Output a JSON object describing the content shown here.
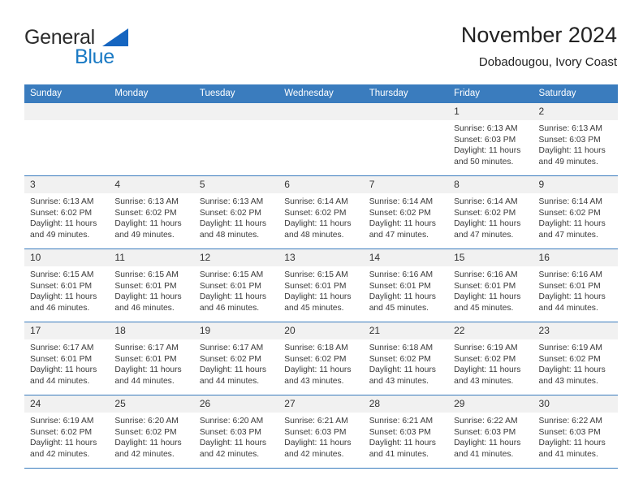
{
  "logo": {
    "word_one": "General",
    "word_two": "Blue",
    "accent_color": "#1a7ac4",
    "triangle_color": "#1565c0"
  },
  "header": {
    "title": "November 2024",
    "subtitle": "Dobadougou, Ivory Coast"
  },
  "theme": {
    "header_row_color": "#3a7cbe",
    "daynum_band_color": "#f1f1f1",
    "text_color": "#3a3a3a"
  },
  "weekday_headers": [
    "Sunday",
    "Monday",
    "Tuesday",
    "Wednesday",
    "Thursday",
    "Friday",
    "Saturday"
  ],
  "weeks": [
    [
      {
        "day": "",
        "empty": true
      },
      {
        "day": "",
        "empty": true
      },
      {
        "day": "",
        "empty": true
      },
      {
        "day": "",
        "empty": true
      },
      {
        "day": "",
        "empty": true
      },
      {
        "day": "1",
        "sunrise": "Sunrise: 6:13 AM",
        "sunset": "Sunset: 6:03 PM",
        "daylight1": "Daylight: 11 hours",
        "daylight2": "and 50 minutes."
      },
      {
        "day": "2",
        "sunrise": "Sunrise: 6:13 AM",
        "sunset": "Sunset: 6:03 PM",
        "daylight1": "Daylight: 11 hours",
        "daylight2": "and 49 minutes."
      }
    ],
    [
      {
        "day": "3",
        "sunrise": "Sunrise: 6:13 AM",
        "sunset": "Sunset: 6:02 PM",
        "daylight1": "Daylight: 11 hours",
        "daylight2": "and 49 minutes."
      },
      {
        "day": "4",
        "sunrise": "Sunrise: 6:13 AM",
        "sunset": "Sunset: 6:02 PM",
        "daylight1": "Daylight: 11 hours",
        "daylight2": "and 49 minutes."
      },
      {
        "day": "5",
        "sunrise": "Sunrise: 6:13 AM",
        "sunset": "Sunset: 6:02 PM",
        "daylight1": "Daylight: 11 hours",
        "daylight2": "and 48 minutes."
      },
      {
        "day": "6",
        "sunrise": "Sunrise: 6:14 AM",
        "sunset": "Sunset: 6:02 PM",
        "daylight1": "Daylight: 11 hours",
        "daylight2": "and 48 minutes."
      },
      {
        "day": "7",
        "sunrise": "Sunrise: 6:14 AM",
        "sunset": "Sunset: 6:02 PM",
        "daylight1": "Daylight: 11 hours",
        "daylight2": "and 47 minutes."
      },
      {
        "day": "8",
        "sunrise": "Sunrise: 6:14 AM",
        "sunset": "Sunset: 6:02 PM",
        "daylight1": "Daylight: 11 hours",
        "daylight2": "and 47 minutes."
      },
      {
        "day": "9",
        "sunrise": "Sunrise: 6:14 AM",
        "sunset": "Sunset: 6:02 PM",
        "daylight1": "Daylight: 11 hours",
        "daylight2": "and 47 minutes."
      }
    ],
    [
      {
        "day": "10",
        "sunrise": "Sunrise: 6:15 AM",
        "sunset": "Sunset: 6:01 PM",
        "daylight1": "Daylight: 11 hours",
        "daylight2": "and 46 minutes."
      },
      {
        "day": "11",
        "sunrise": "Sunrise: 6:15 AM",
        "sunset": "Sunset: 6:01 PM",
        "daylight1": "Daylight: 11 hours",
        "daylight2": "and 46 minutes."
      },
      {
        "day": "12",
        "sunrise": "Sunrise: 6:15 AM",
        "sunset": "Sunset: 6:01 PM",
        "daylight1": "Daylight: 11 hours",
        "daylight2": "and 46 minutes."
      },
      {
        "day": "13",
        "sunrise": "Sunrise: 6:15 AM",
        "sunset": "Sunset: 6:01 PM",
        "daylight1": "Daylight: 11 hours",
        "daylight2": "and 45 minutes."
      },
      {
        "day": "14",
        "sunrise": "Sunrise: 6:16 AM",
        "sunset": "Sunset: 6:01 PM",
        "daylight1": "Daylight: 11 hours",
        "daylight2": "and 45 minutes."
      },
      {
        "day": "15",
        "sunrise": "Sunrise: 6:16 AM",
        "sunset": "Sunset: 6:01 PM",
        "daylight1": "Daylight: 11 hours",
        "daylight2": "and 45 minutes."
      },
      {
        "day": "16",
        "sunrise": "Sunrise: 6:16 AM",
        "sunset": "Sunset: 6:01 PM",
        "daylight1": "Daylight: 11 hours",
        "daylight2": "and 44 minutes."
      }
    ],
    [
      {
        "day": "17",
        "sunrise": "Sunrise: 6:17 AM",
        "sunset": "Sunset: 6:01 PM",
        "daylight1": "Daylight: 11 hours",
        "daylight2": "and 44 minutes."
      },
      {
        "day": "18",
        "sunrise": "Sunrise: 6:17 AM",
        "sunset": "Sunset: 6:01 PM",
        "daylight1": "Daylight: 11 hours",
        "daylight2": "and 44 minutes."
      },
      {
        "day": "19",
        "sunrise": "Sunrise: 6:17 AM",
        "sunset": "Sunset: 6:02 PM",
        "daylight1": "Daylight: 11 hours",
        "daylight2": "and 44 minutes."
      },
      {
        "day": "20",
        "sunrise": "Sunrise: 6:18 AM",
        "sunset": "Sunset: 6:02 PM",
        "daylight1": "Daylight: 11 hours",
        "daylight2": "and 43 minutes."
      },
      {
        "day": "21",
        "sunrise": "Sunrise: 6:18 AM",
        "sunset": "Sunset: 6:02 PM",
        "daylight1": "Daylight: 11 hours",
        "daylight2": "and 43 minutes."
      },
      {
        "day": "22",
        "sunrise": "Sunrise: 6:19 AM",
        "sunset": "Sunset: 6:02 PM",
        "daylight1": "Daylight: 11 hours",
        "daylight2": "and 43 minutes."
      },
      {
        "day": "23",
        "sunrise": "Sunrise: 6:19 AM",
        "sunset": "Sunset: 6:02 PM",
        "daylight1": "Daylight: 11 hours",
        "daylight2": "and 43 minutes."
      }
    ],
    [
      {
        "day": "24",
        "sunrise": "Sunrise: 6:19 AM",
        "sunset": "Sunset: 6:02 PM",
        "daylight1": "Daylight: 11 hours",
        "daylight2": "and 42 minutes."
      },
      {
        "day": "25",
        "sunrise": "Sunrise: 6:20 AM",
        "sunset": "Sunset: 6:02 PM",
        "daylight1": "Daylight: 11 hours",
        "daylight2": "and 42 minutes."
      },
      {
        "day": "26",
        "sunrise": "Sunrise: 6:20 AM",
        "sunset": "Sunset: 6:03 PM",
        "daylight1": "Daylight: 11 hours",
        "daylight2": "and 42 minutes."
      },
      {
        "day": "27",
        "sunrise": "Sunrise: 6:21 AM",
        "sunset": "Sunset: 6:03 PM",
        "daylight1": "Daylight: 11 hours",
        "daylight2": "and 42 minutes."
      },
      {
        "day": "28",
        "sunrise": "Sunrise: 6:21 AM",
        "sunset": "Sunset: 6:03 PM",
        "daylight1": "Daylight: 11 hours",
        "daylight2": "and 41 minutes."
      },
      {
        "day": "29",
        "sunrise": "Sunrise: 6:22 AM",
        "sunset": "Sunset: 6:03 PM",
        "daylight1": "Daylight: 11 hours",
        "daylight2": "and 41 minutes."
      },
      {
        "day": "30",
        "sunrise": "Sunrise: 6:22 AM",
        "sunset": "Sunset: 6:03 PM",
        "daylight1": "Daylight: 11 hours",
        "daylight2": "and 41 minutes."
      }
    ]
  ]
}
